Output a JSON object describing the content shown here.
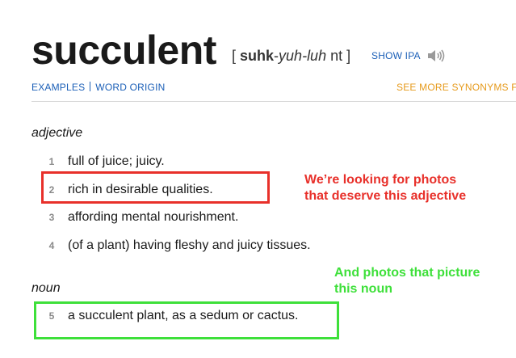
{
  "entry": {
    "headword": "succulent",
    "pronunciation": {
      "open_bracket": "[",
      "stressed": "suhk",
      "hyphen": "-",
      "italic": "yuh-luh",
      "rest": "nt",
      "close_bracket": "]"
    },
    "show_ipa_label": "SHOW IPA",
    "speaker_icon": "speaker-icon"
  },
  "subnav": {
    "examples_label": "EXAMPLES",
    "word_origin_label": "WORD ORIGIN",
    "see_more_synonyms_label": "SEE MORE SYNONYMS FO"
  },
  "sections": {
    "adjective": {
      "label": "adjective",
      "definitions": [
        {
          "number": "1",
          "text": "full of juice; juicy."
        },
        {
          "number": "2",
          "text": "rich in desirable qualities."
        },
        {
          "number": "3",
          "text": "affording mental nourishment."
        },
        {
          "number": "4",
          "text": "(of a plant) having fleshy and juicy tissues."
        }
      ]
    },
    "noun": {
      "label": "noun",
      "definitions": [
        {
          "number": "5",
          "text": "a succulent plant, as a sedum or cactus."
        }
      ]
    }
  },
  "annotations": {
    "red_note": {
      "line1": "We’re looking for photos",
      "line2": "that deserve this adjective",
      "color": "#e8302a"
    },
    "green_note": {
      "line1": "And photos that picture",
      "line2": "this noun",
      "color": "#3ee03a"
    }
  },
  "colors": {
    "link_blue": "#1b5fb7",
    "synonyms_orange": "#e69a1b",
    "text_dark": "#1a1a1a",
    "number_gray": "#8a8a8a"
  }
}
